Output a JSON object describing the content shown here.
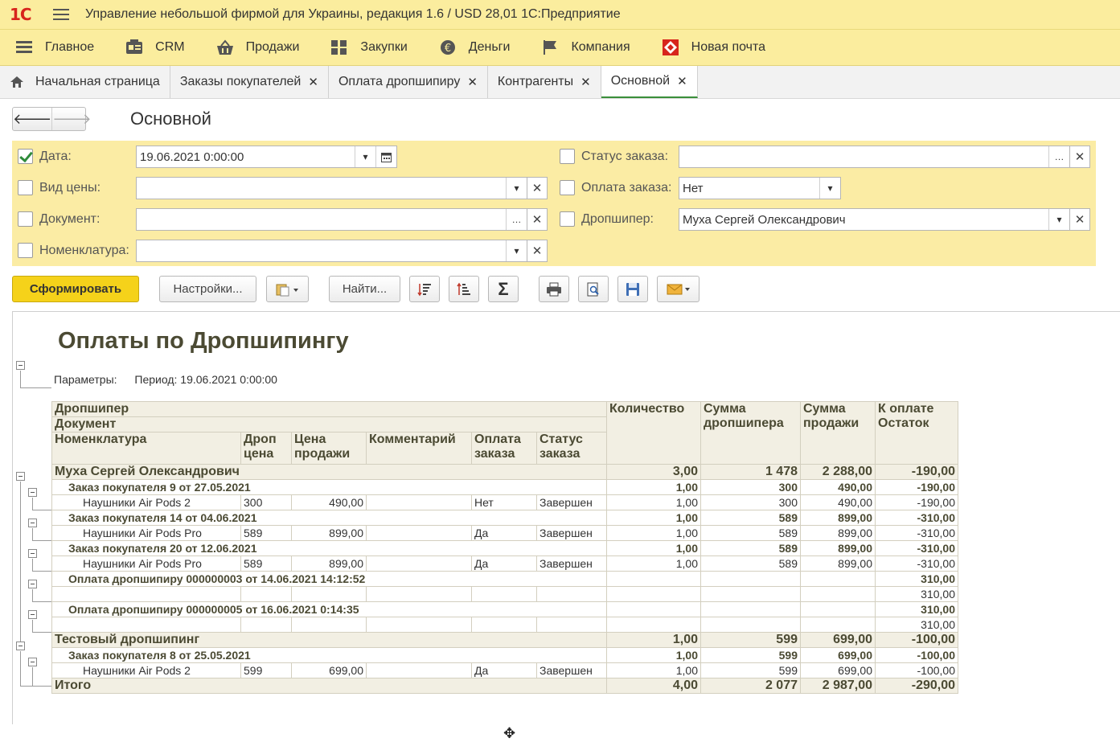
{
  "titlebar": {
    "logo": "1С",
    "title": "Управление небольшой фирмой для Украины, редакция 1.6 / USD 28,01 1С:Предприятие"
  },
  "menu": [
    {
      "label": "Главное",
      "icon": "list-icon"
    },
    {
      "label": "CRM",
      "icon": "crm-icon"
    },
    {
      "label": "Продажи",
      "icon": "basket-icon"
    },
    {
      "label": "Закупки",
      "icon": "purchases-icon"
    },
    {
      "label": "Деньги",
      "icon": "money-icon"
    },
    {
      "label": "Компания",
      "icon": "flag-icon"
    },
    {
      "label": "Новая почта",
      "icon": "nova-poshta-icon"
    }
  ],
  "tabs": [
    {
      "label": "Начальная страница",
      "closable": false
    },
    {
      "label": "Заказы покупателей",
      "closable": true
    },
    {
      "label": "Оплата дропшипиру",
      "closable": true
    },
    {
      "label": "Контрагенты",
      "closable": true
    },
    {
      "label": "Основной",
      "closable": true,
      "active": true
    }
  ],
  "form": {
    "title": "Основной",
    "filters": {
      "date": {
        "label": "Дата:",
        "checked": true,
        "value": "19.06.2021  0:00:00"
      },
      "price_type": {
        "label": "Вид цены:",
        "checked": false,
        "value": ""
      },
      "document": {
        "label": "Документ:",
        "checked": false,
        "value": ""
      },
      "nomenclature": {
        "label": "Номенклатура:",
        "checked": false,
        "value": ""
      },
      "order_status": {
        "label": "Статус заказа:",
        "checked": false,
        "value": ""
      },
      "order_payment": {
        "label": "Оплата заказа:",
        "checked": false,
        "value": "Нет"
      },
      "dropshipper": {
        "label": "Дропшипер:",
        "checked": false,
        "value": "Муха Сергей Олександрович"
      }
    }
  },
  "toolbar": {
    "generate": "Сформировать",
    "settings": "Настройки...",
    "find": "Найти..."
  },
  "report": {
    "title": "Оплаты по Дропшипингу",
    "params_label": "Параметры:",
    "params_value": "Период: 19.06.2021 0:00:00",
    "headers": {
      "dropshipper": "Дропшипер",
      "document": "Документ",
      "nomenclature": "Номенклатура",
      "drop_price_1": "Дроп",
      "drop_price_2": "цена",
      "sale_price_1": "Цена",
      "sale_price_2": "продажи",
      "comment": "Комментарий",
      "order_pay_1": "Оплата",
      "order_pay_2": "заказа",
      "order_status_1": "Статус",
      "order_status_2": "заказа",
      "qty": "Количество",
      "drop_sum_1": "Сумма",
      "drop_sum_2": "дропшипера",
      "sale_sum_1": "Сумма",
      "sale_sum_2": "продажи",
      "topay_1": "К оплате",
      "topay_2": "Остаток"
    },
    "rows": [
      {
        "kind": "g1",
        "name": "Муха Сергей Олександрович",
        "qty": "3,00",
        "dsum": "1 478",
        "ssum": "2 288,00",
        "pay": "-190,00",
        "payc": "red"
      },
      {
        "kind": "g2",
        "name": "Заказ покупателя 9 от 27.05.2021",
        "qty": "1,00",
        "dsum": "300",
        "ssum": "490,00",
        "pay": "-190,00",
        "payc": "red"
      },
      {
        "kind": "dt",
        "name": "Наушники Air Pods 2",
        "dprice": "300",
        "sprice": "490,00",
        "comment": "",
        "opay": "Нет",
        "opayc": "red",
        "ostat": "Завершен",
        "qty": "1,00",
        "dsum": "300",
        "ssum": "490,00",
        "pay": "-190,00",
        "payc": "red"
      },
      {
        "kind": "g2",
        "name": "Заказ покупателя 14 от 04.06.2021",
        "qty": "1,00",
        "dsum": "589",
        "ssum": "899,00",
        "pay": "-310,00",
        "payc": "red"
      },
      {
        "kind": "dt",
        "name": "Наушники Air Pods Pro",
        "dprice": "589",
        "sprice": "899,00",
        "comment": "",
        "opay": "Да",
        "opayc": "",
        "ostat": "Завершен",
        "qty": "1,00",
        "dsum": "589",
        "ssum": "899,00",
        "pay": "-310,00",
        "payc": "red"
      },
      {
        "kind": "g2",
        "name": "Заказ покупателя 20 от 12.06.2021",
        "qty": "1,00",
        "dsum": "589",
        "ssum": "899,00",
        "pay": "-310,00",
        "payc": "red"
      },
      {
        "kind": "dt",
        "name": "Наушники Air Pods Pro",
        "dprice": "589",
        "sprice": "899,00",
        "comment": "",
        "opay": "Да",
        "opayc": "",
        "ostat": "Завершен",
        "qty": "1,00",
        "dsum": "589",
        "ssum": "899,00",
        "pay": "-310,00",
        "payc": "red"
      },
      {
        "kind": "g2",
        "name": "Оплата дропшипиру 000000003 от 14.06.2021 14:12:52",
        "qty": "",
        "dsum": "",
        "ssum": "",
        "pay": "310,00",
        "payc": "green"
      },
      {
        "kind": "dt",
        "name": "",
        "dprice": "",
        "sprice": "",
        "comment": "",
        "opay": "",
        "opayc": "",
        "ostat": "",
        "qty": "",
        "dsum": "",
        "ssum": "",
        "pay": "310,00",
        "payc": "green"
      },
      {
        "kind": "g2",
        "name": "Оплата дропшипиру 000000005 от 16.06.2021 0:14:35",
        "qty": "",
        "dsum": "",
        "ssum": "",
        "pay": "310,00",
        "payc": "green"
      },
      {
        "kind": "dt",
        "name": "",
        "dprice": "",
        "sprice": "",
        "comment": "",
        "opay": "",
        "opayc": "",
        "ostat": "",
        "qty": "",
        "dsum": "",
        "ssum": "",
        "pay": "310,00",
        "payc": "green"
      },
      {
        "kind": "g1",
        "name": "Тестовый дропшипинг",
        "qty": "1,00",
        "dsum": "599",
        "ssum": "699,00",
        "pay": "-100,00",
        "payc": "red"
      },
      {
        "kind": "g2",
        "name": "Заказ покупателя 8 от 25.05.2021",
        "qty": "1,00",
        "dsum": "599",
        "ssum": "699,00",
        "pay": "-100,00",
        "payc": "red"
      },
      {
        "kind": "dt",
        "name": "Наушники Air Pods 2",
        "dprice": "599",
        "sprice": "699,00",
        "comment": "",
        "opay": "Да",
        "opayc": "",
        "ostat": "Завершен",
        "qty": "1,00",
        "dsum": "599",
        "ssum": "699,00",
        "pay": "-100,00",
        "payc": "red"
      },
      {
        "kind": "tot",
        "name": "Итого",
        "qty": "4,00",
        "dsum": "2 077",
        "ssum": "2 987,00",
        "pay": "-290,00",
        "payc": "red"
      }
    ]
  },
  "colors": {
    "accent": "#f5d21a",
    "panel": "#fbeca4",
    "negative": "#e0141c",
    "positive": "#27b01c"
  }
}
